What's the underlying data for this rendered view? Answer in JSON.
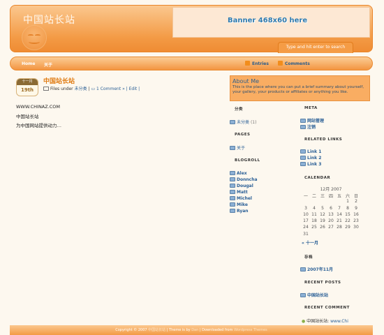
{
  "header": {
    "site_title": "中国站长站",
    "banner_text": "Banner 468x60 here",
    "search_placeholder": "Type and hit enter to search"
  },
  "nav": {
    "home": "Home",
    "about": "关于",
    "entries": "Entries",
    "comments": "Comments"
  },
  "post": {
    "month": "十一月",
    "day": "19th",
    "title": "中国站长站",
    "files_under": "Files under",
    "category": "未分类",
    "comment_link": "1 Comment »",
    "edit": "| Edit |",
    "paragraphs": [
      "WWW.CHINAZ.COM",
      "中国站长站",
      "为中国网站提供动力…"
    ]
  },
  "about": {
    "title": "About Me",
    "text": "This is the place where you can put a brief summary about yourself, your gallery, your products or affiliates or anything you like."
  },
  "sidebar_left": {
    "categories_heading": "分类",
    "categories": [
      {
        "name": "未分类",
        "count": "(1)"
      }
    ],
    "pages_heading": "PAGES",
    "pages": [
      "关于"
    ],
    "blogroll_heading": "BLOGROLL",
    "blogroll": [
      "Alex",
      "Donncha",
      "Dougal",
      "Matt",
      "Michel",
      "Mike",
      "Ryan"
    ]
  },
  "sidebar_right": {
    "meta_heading": "META",
    "meta": [
      "网站管理",
      "注销"
    ],
    "related_heading": "RELATED LINKS",
    "related": [
      "Link 1",
      "Link 2",
      "Link 3"
    ],
    "calendar_heading": "CALENDAR",
    "archives_heading": "存档",
    "archives": [
      "2007年11月"
    ],
    "recent_posts_heading": "RECENT POSTS",
    "recent_posts": [
      "中国站长站"
    ],
    "recent_comment_heading": "RECENT COMMENT",
    "recent_comment": {
      "title": "中国站长站:",
      "link": "www.Chi"
    }
  },
  "calendar": {
    "caption": "12月 2007",
    "weekdays": [
      "一",
      "二",
      "三",
      "四",
      "五",
      "六",
      "日"
    ],
    "weeks": [
      [
        "",
        "",
        "",
        "",
        "",
        "1",
        "2"
      ],
      [
        "3",
        "4",
        "5",
        "6",
        "7",
        "8",
        "9"
      ],
      [
        "10",
        "11",
        "12",
        "13",
        "14",
        "15",
        "16"
      ],
      [
        "17",
        "18",
        "19",
        "20",
        "21",
        "22",
        "23"
      ],
      [
        "24",
        "25",
        "26",
        "27",
        "28",
        "29",
        "30"
      ],
      [
        "31",
        "",
        "",
        "",
        "",
        "",
        ""
      ]
    ],
    "prev": "« 十一月"
  },
  "footer": {
    "copyright": "Copyright © 2007",
    "site": "中国站长站",
    "theme_label": "| Theme is by",
    "author": "Dan",
    "downloaded": "| Downloaded from",
    "source": "Wordpress Themes"
  },
  "colors": {
    "accent": "#f39a45",
    "link": "#2a5f96",
    "background": "#fdf8ef"
  }
}
